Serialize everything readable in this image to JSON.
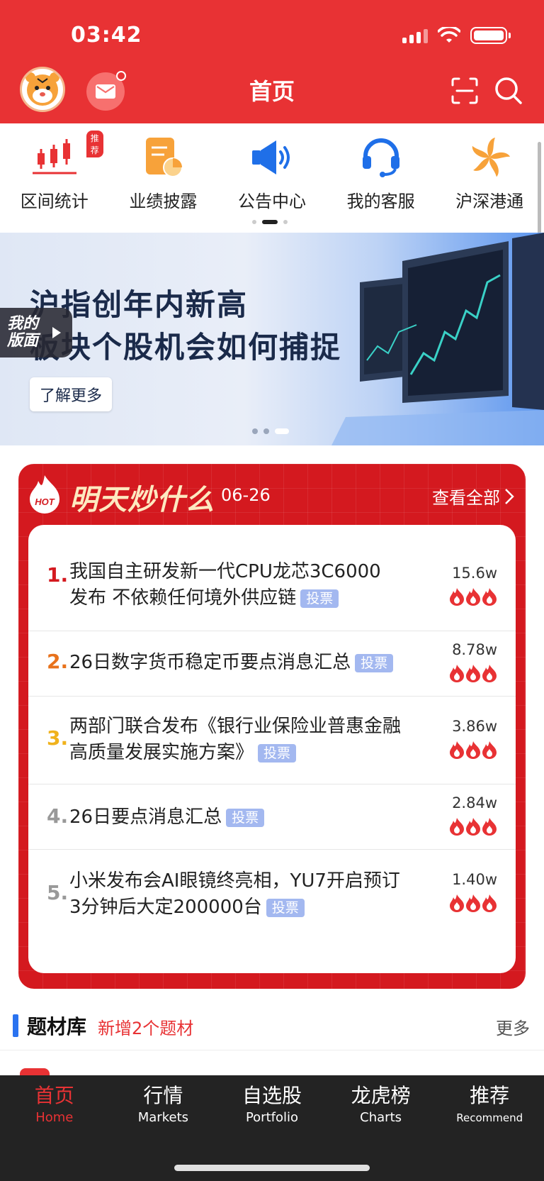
{
  "status_bar": {
    "time": "03:42"
  },
  "header": {
    "title": "首页"
  },
  "quick_menu": [
    {
      "label": "区间统计",
      "tag": "推荐",
      "icon": "candlestick-icon"
    },
    {
      "label": "业绩披露",
      "icon": "report-icon"
    },
    {
      "label": "公告中心",
      "icon": "megaphone-icon"
    },
    {
      "label": "我的客服",
      "icon": "headset-icon"
    },
    {
      "label": "沪深港通",
      "icon": "bauhinia-icon"
    }
  ],
  "banner": {
    "line1": "沪指创年内新高",
    "line2": "板块个股机会如何捕捉",
    "button": "了解更多",
    "side_tab": "我的版面"
  },
  "hot": {
    "badge": "HOT",
    "title": "明天炒什么",
    "date": "06-26",
    "view_all": "查看全部",
    "vote_label": "投票",
    "items": [
      {
        "rank": "1.",
        "line1": "我国自主研发新一代CPU龙芯3C6000",
        "line2": "发布 不依赖任何境外供应链",
        "count": "15.6w",
        "rank_color": "#d4191f"
      },
      {
        "rank": "2.",
        "line1": "26日数字货币稳定币要点消息汇总",
        "line2": "",
        "count": "8.78w",
        "rank_color": "#e8721c"
      },
      {
        "rank": "3.",
        "line1": "两部门联合发布《银行业保险业普惠金融",
        "line2": "高质量发展实施方案》",
        "count": "3.86w",
        "rank_color": "#f0b21c"
      },
      {
        "rank": "4.",
        "line1": "26日要点消息汇总",
        "line2": "",
        "count": "2.84w",
        "rank_color": "#999999"
      },
      {
        "rank": "5.",
        "line1": "小米发布会AI眼镜终亮相，YU7开启预订",
        "line2": "3分钟后大定200000台",
        "count": "1.40w",
        "rank_color": "#999999"
      }
    ]
  },
  "topics": {
    "title": "题材库",
    "new_text": "新增2个题材",
    "more": "更多"
  },
  "bottom_nav": [
    {
      "cn": "首页",
      "en": "Home",
      "active": true
    },
    {
      "cn": "行情",
      "en": "Markets"
    },
    {
      "cn": "自选股",
      "en": "Portfolio"
    },
    {
      "cn": "龙虎榜",
      "en": "Charts"
    },
    {
      "cn": "推荐",
      "en": "Recommend"
    }
  ],
  "colors": {
    "brand_red": "#e83234",
    "card_red": "#d4191f",
    "vote_blue": "#a3b8f0",
    "topic_blue": "#2a73f0"
  }
}
